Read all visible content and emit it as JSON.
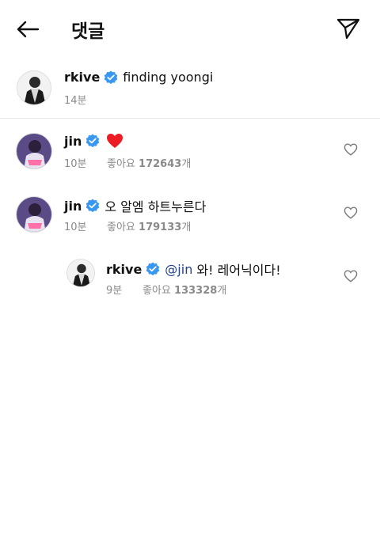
{
  "header": {
    "title": "댓글",
    "back_icon": "arrow-left-icon",
    "send_icon": "paper-plane-icon"
  },
  "caption": {
    "username": "rkive",
    "text": "finding yoongi",
    "time": "14분"
  },
  "comments": [
    {
      "username": "jin",
      "text": "",
      "emoji": "heart-emoji",
      "time": "10분",
      "likes_prefix": "좋아요",
      "likes_count": "172643",
      "likes_suffix": "개"
    },
    {
      "username": "jin",
      "text": "오 알엠 하트누른다",
      "time": "10분",
      "likes_prefix": "좋아요",
      "likes_count": "179133",
      "likes_suffix": "개"
    }
  ],
  "reply": {
    "username": "rkive",
    "mention": "@jin",
    "text": " 와! 레어닉이다!",
    "time": "9분",
    "likes_prefix": "좋아요",
    "likes_count": "133328",
    "likes_suffix": "개"
  },
  "colors": {
    "verified": "#3897f0",
    "mention": "#1f3f8f",
    "meta": "#8a8a8a",
    "heart": "#ed1c24"
  }
}
